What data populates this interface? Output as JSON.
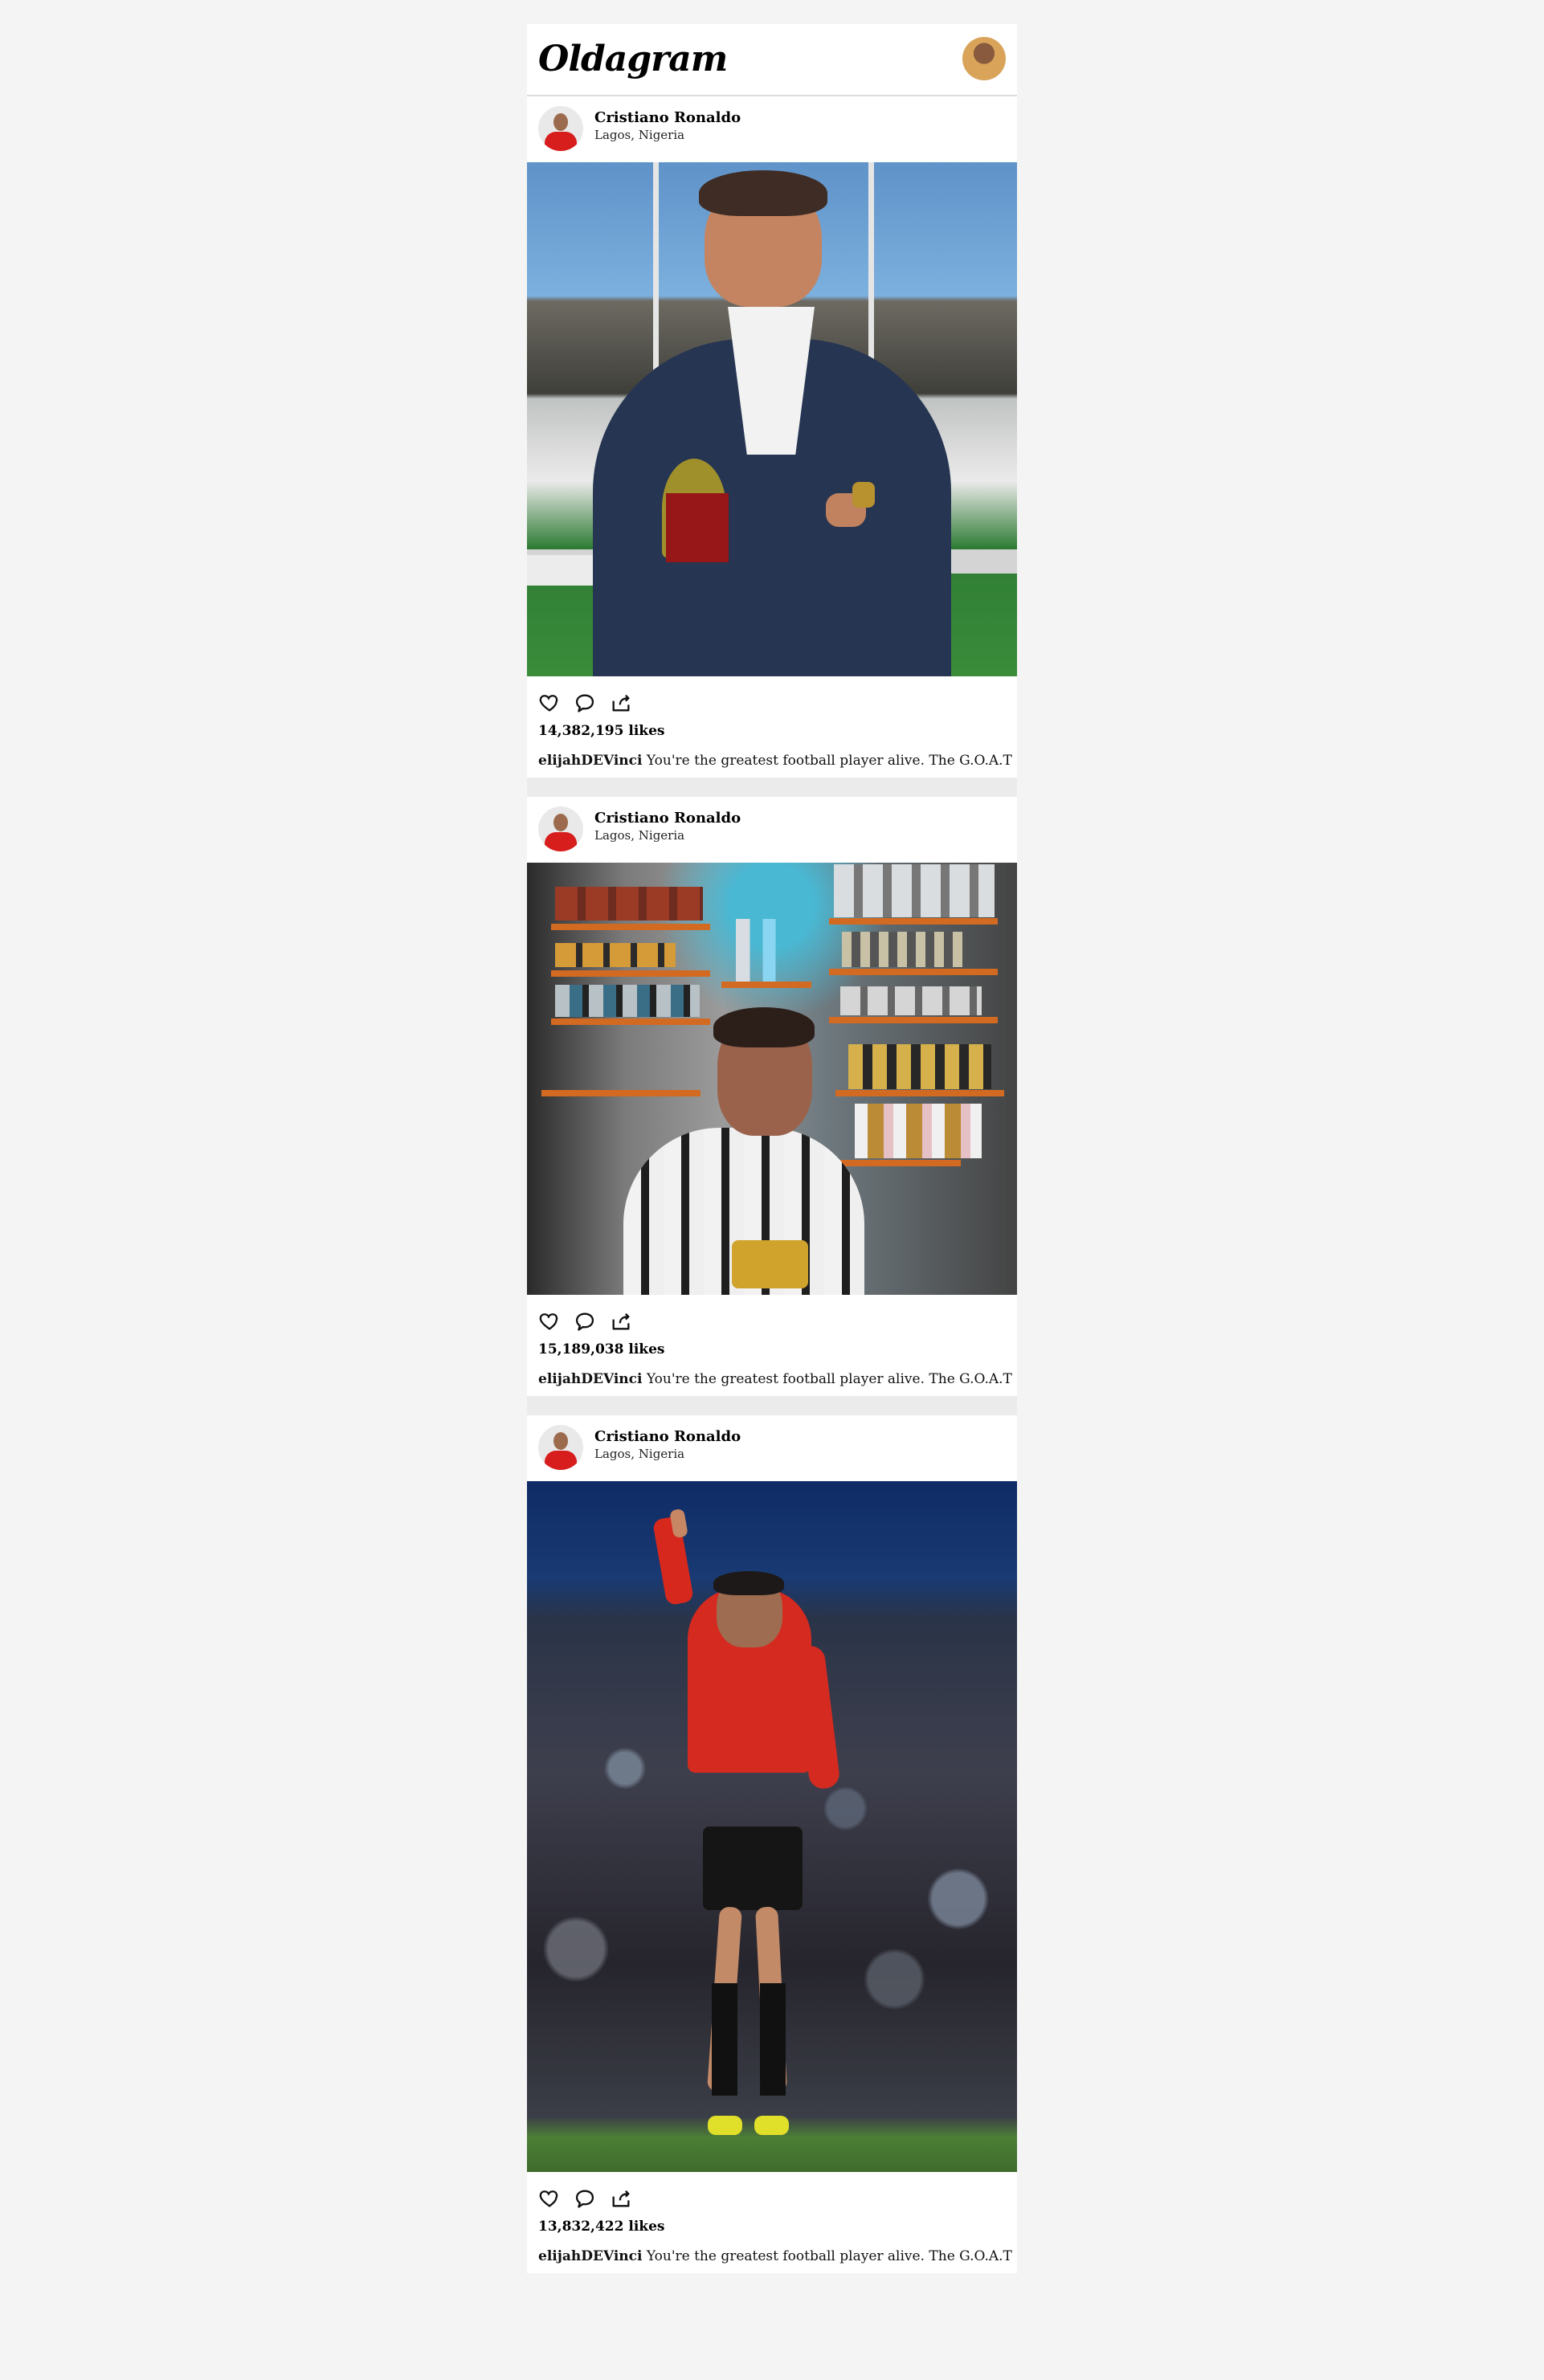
{
  "app": {
    "title": "Oldagram"
  },
  "posts": [
    {
      "name": "Cristiano Ronaldo",
      "location": "Lagos, Nigeria",
      "likes": "14,382,195 likes",
      "comment_user": "elijahDEVinci",
      "comment_text": "You're the greatest football player alive. The G.O.A.T"
    },
    {
      "name": "Cristiano Ronaldo",
      "location": "Lagos, Nigeria",
      "likes": "15,189,038 likes",
      "comment_user": "elijahDEVinci",
      "comment_text": "You're the greatest football player alive. The G.O.A.T"
    },
    {
      "name": "Cristiano Ronaldo",
      "location": "Lagos, Nigeria",
      "likes": "13,832,422 likes",
      "comment_user": "elijahDEVinci",
      "comment_text": "You're the greatest football player alive. The G.O.A.T"
    }
  ],
  "icons": {
    "like": "heart-icon",
    "comment": "speech-bubble-icon",
    "share": "share-arrow-icon"
  },
  "colors": {
    "background": "#f4f4f4",
    "card": "#ffffff",
    "divider": "#ebebeb"
  }
}
